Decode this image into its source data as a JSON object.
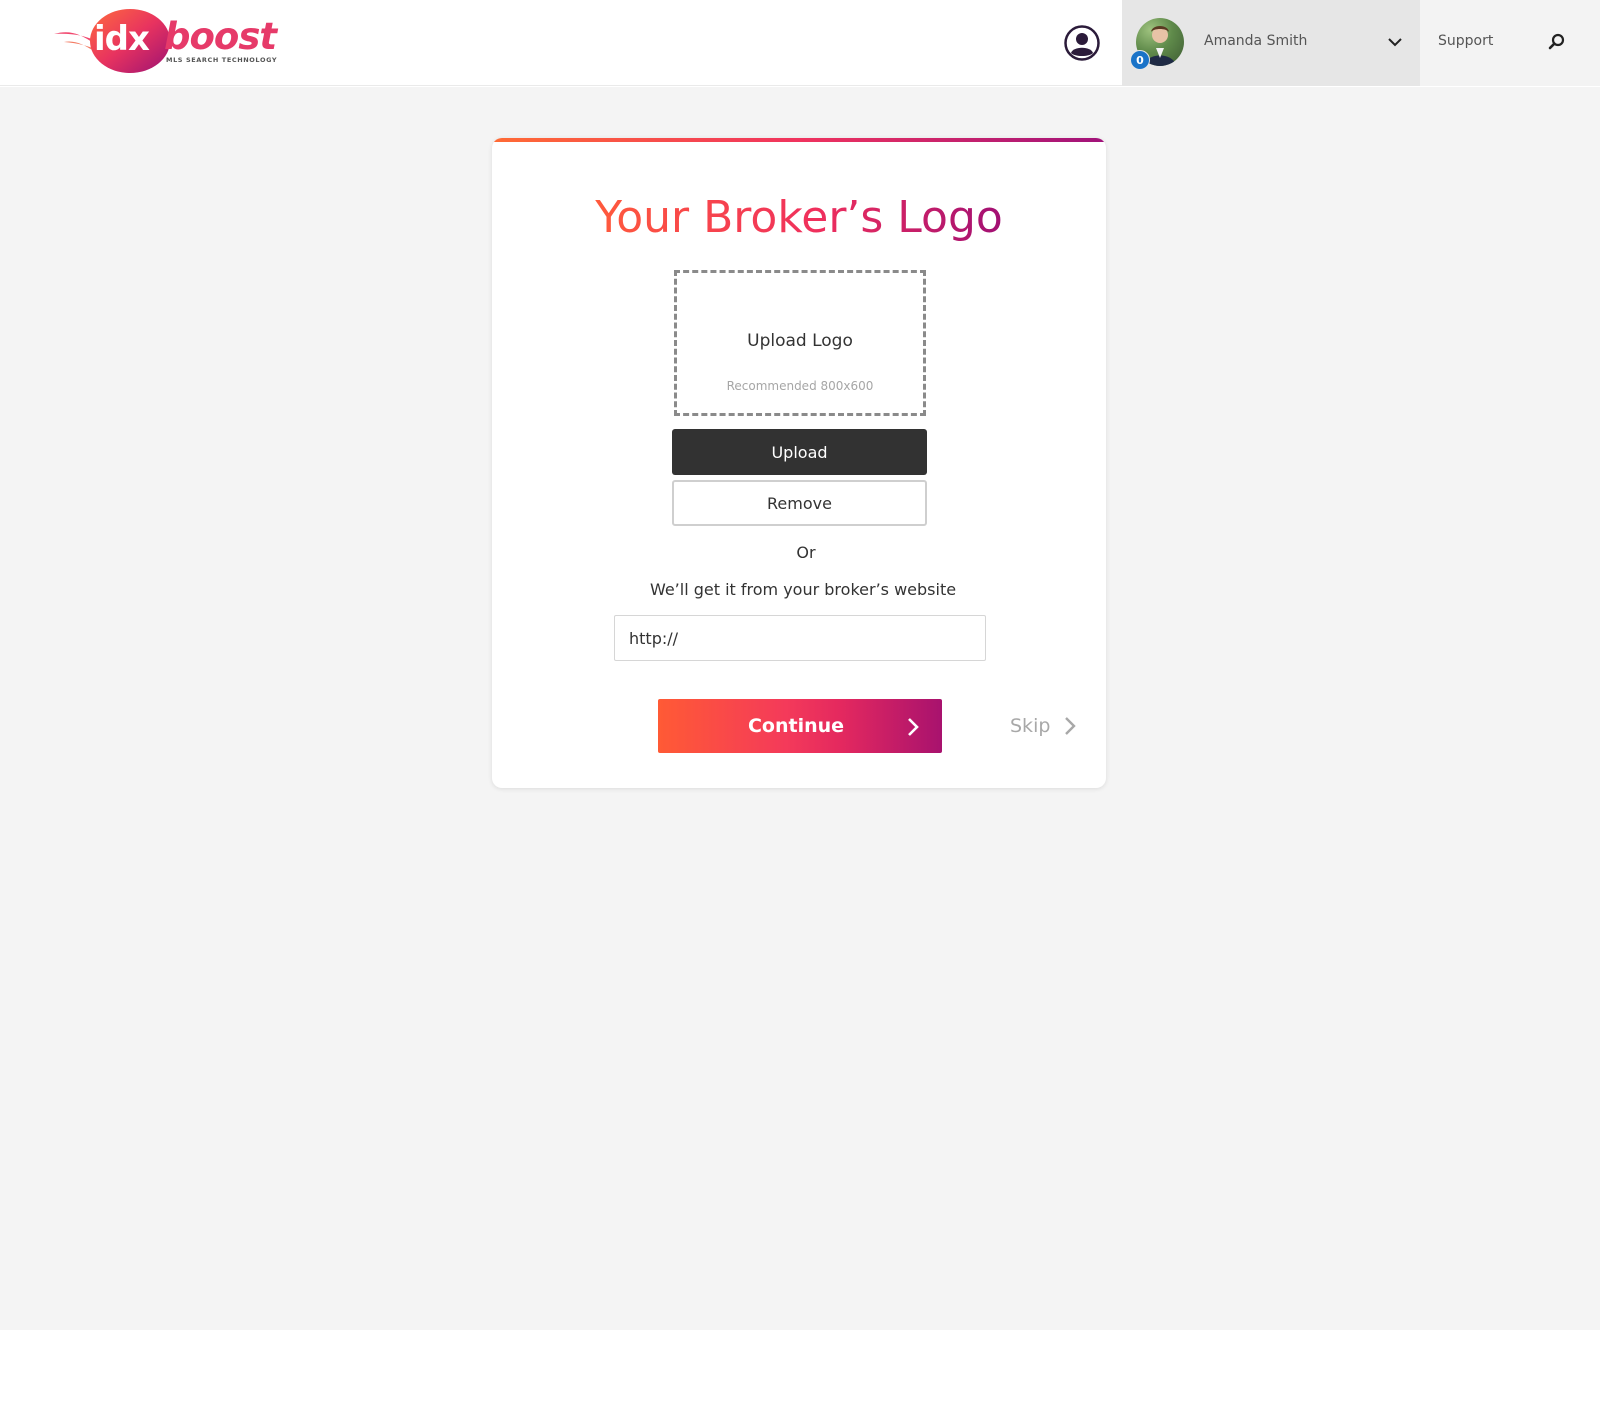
{
  "header": {
    "logo": {
      "idx": "idx",
      "boost": "boost",
      "tagline": "MLS SEARCH TECHNOLOGY",
      "brand_colors": [
        "#e63a69",
        "#a0127a",
        "#ff6b35"
      ]
    },
    "account_icon": "account-circle-icon",
    "user": {
      "name": "Amanda Smith",
      "badge_count": "0",
      "dropdown_icon": "chevron-down-icon"
    },
    "support_label": "Support",
    "search_icon": "search-icon"
  },
  "card": {
    "title": "Your Broker’s Logo",
    "dropzone": {
      "label": "Upload Logo",
      "hint": "Recommended 800x600"
    },
    "upload_button": "Upload",
    "remove_button": "Remove",
    "or_text": "Or",
    "website_prompt": "We’ll get it from your broker’s website",
    "url_input": {
      "value": "http://",
      "placeholder": "http://"
    },
    "continue_button": "Continue",
    "skip_link": "Skip",
    "accent_gradient": [
      "#ff6b35",
      "#f0335e",
      "#a0127a"
    ]
  }
}
